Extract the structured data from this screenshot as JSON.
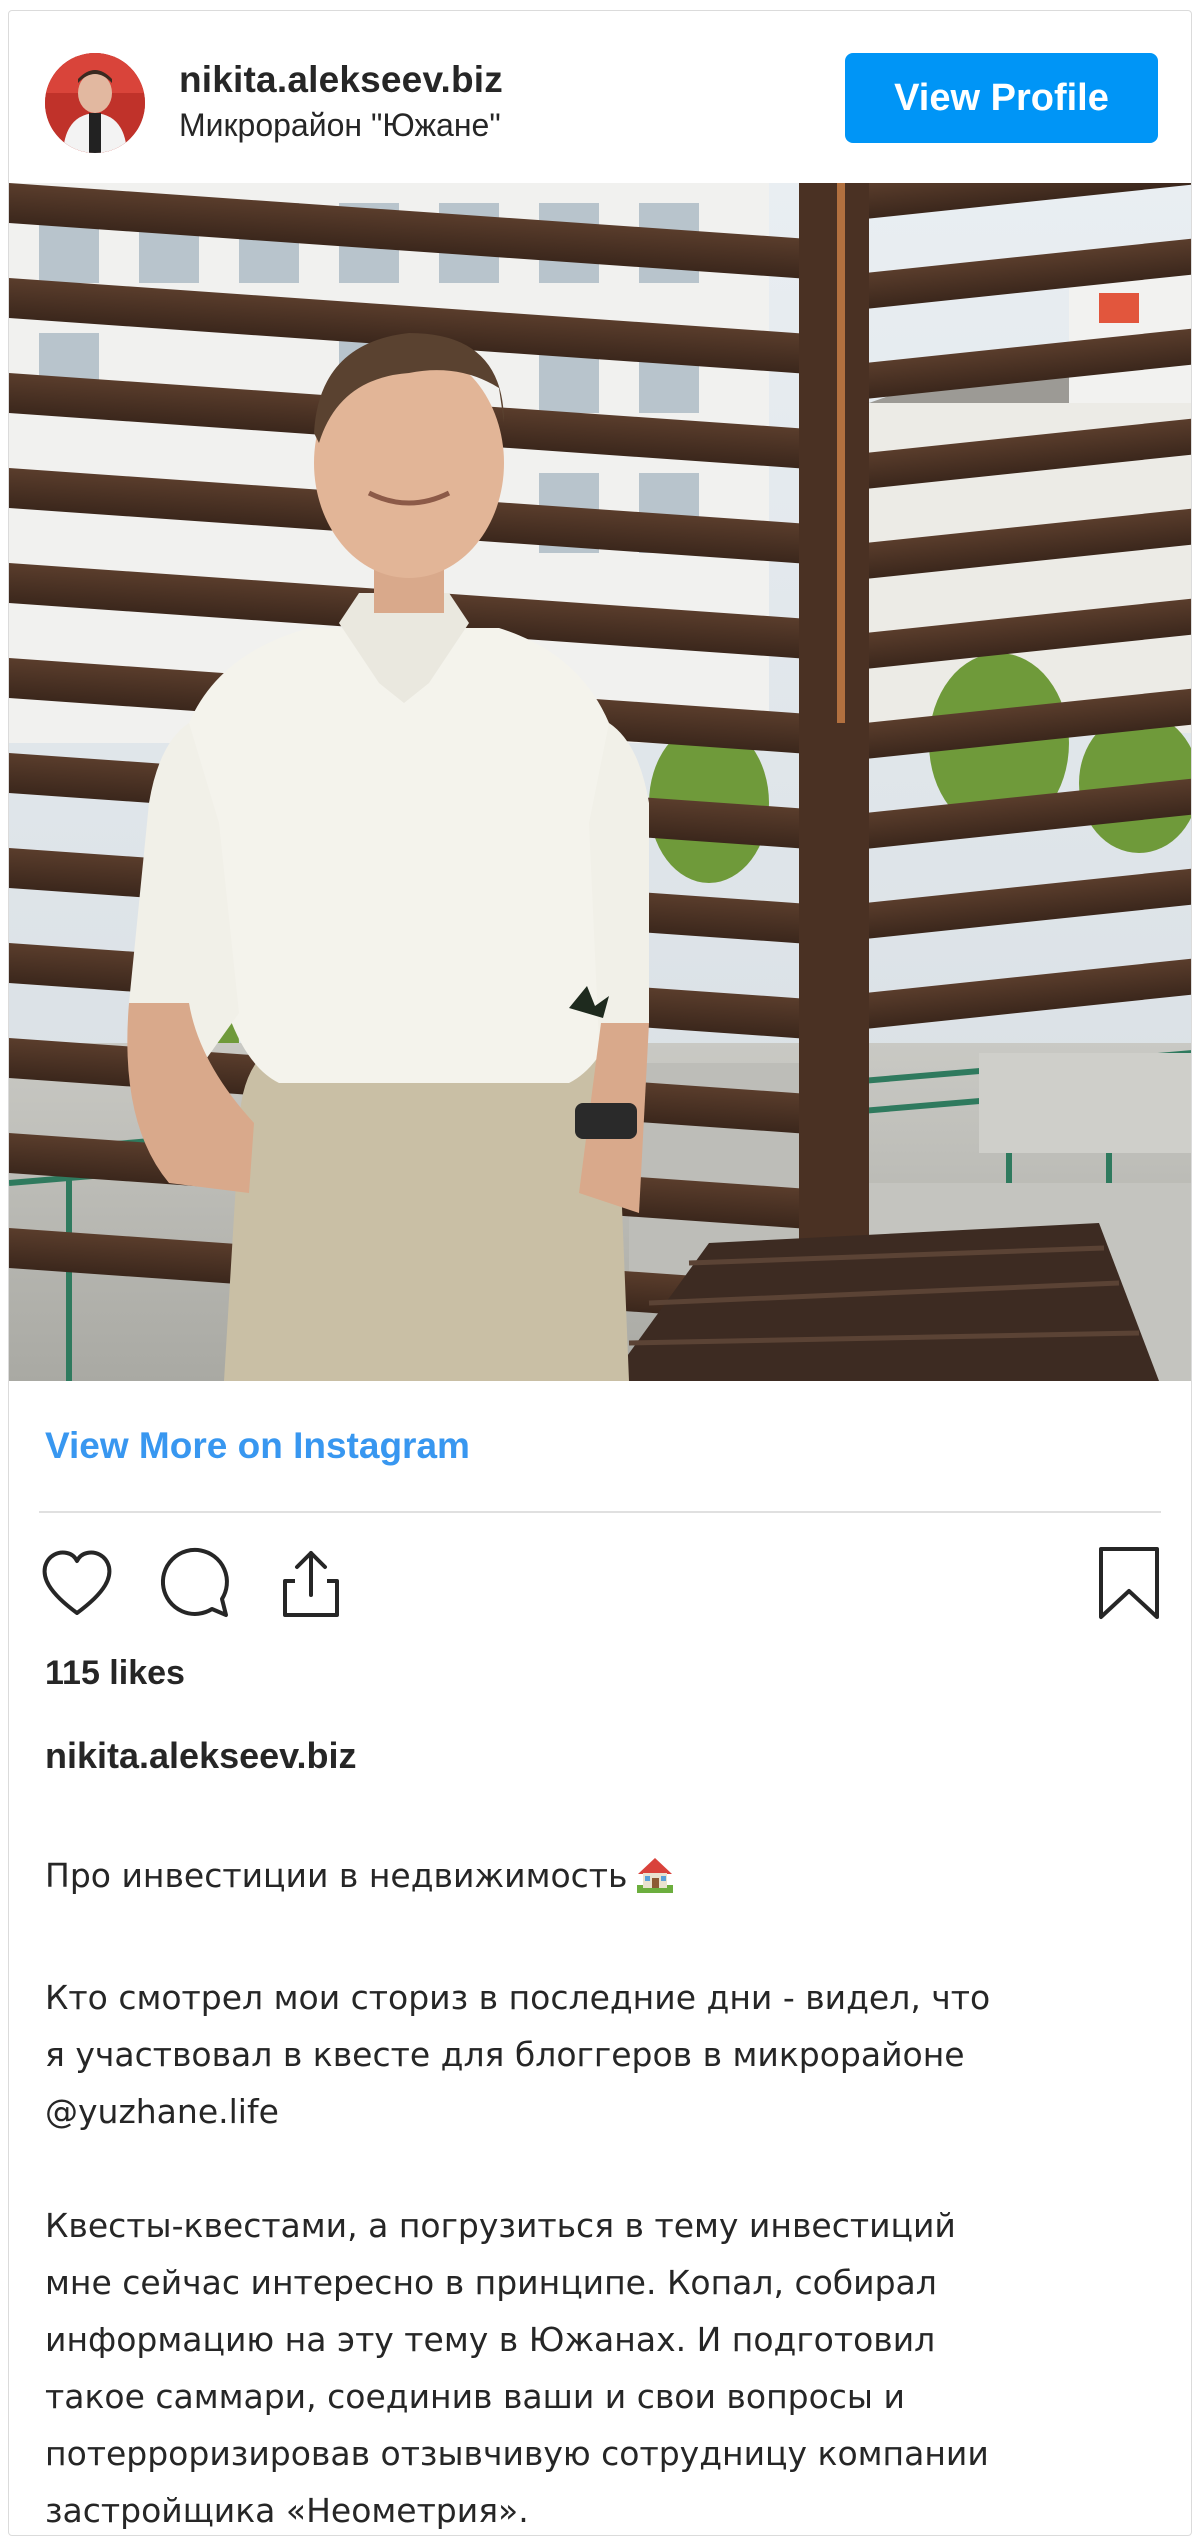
{
  "header": {
    "username": "nikita.alekseev.biz",
    "location": "Микрорайон \"Южане\"",
    "view_profile_label": "View Profile"
  },
  "post": {
    "view_more_label": "View More on Instagram",
    "likes": "115 likes",
    "caption_username": "nikita.alekseev.biz",
    "caption_title": "Про инвестиции в недвижимость",
    "caption_title_emoji": "house-with-garden-icon",
    "caption_paragraph_1_line_1": "Кто смотрел мои сториз в последние дни - видел, что",
    "caption_paragraph_1_line_2": "я участвовал в квесте для блоггеров в микрорайоне",
    "caption_paragraph_1_line_3": "@yuzhane.life",
    "caption_paragraph_2_line_1": "Квесты-квестами, а погрузиться в тему инвестиций",
    "caption_paragraph_2_line_2": "мне сейчас интересно в принципе. Копал, собирал",
    "caption_paragraph_2_line_3": "информацию на эту тему в Южанах. И подготовил",
    "caption_paragraph_2_line_4": "такое саммари, соединив ваши и свои вопросы и",
    "caption_paragraph_2_line_5": "потерроризировав отзывчивую сотрудницу компании",
    "caption_paragraph_2_line_6": "застройщика «Неометрия»."
  },
  "actions": {
    "like_icon": "heart-icon",
    "comment_icon": "comment-icon",
    "share_icon": "share-icon",
    "save_icon": "bookmark-icon"
  },
  "colors": {
    "accent": "#0095f6",
    "link": "#3897f0",
    "text": "#262626",
    "border": "#dbdbdb"
  }
}
